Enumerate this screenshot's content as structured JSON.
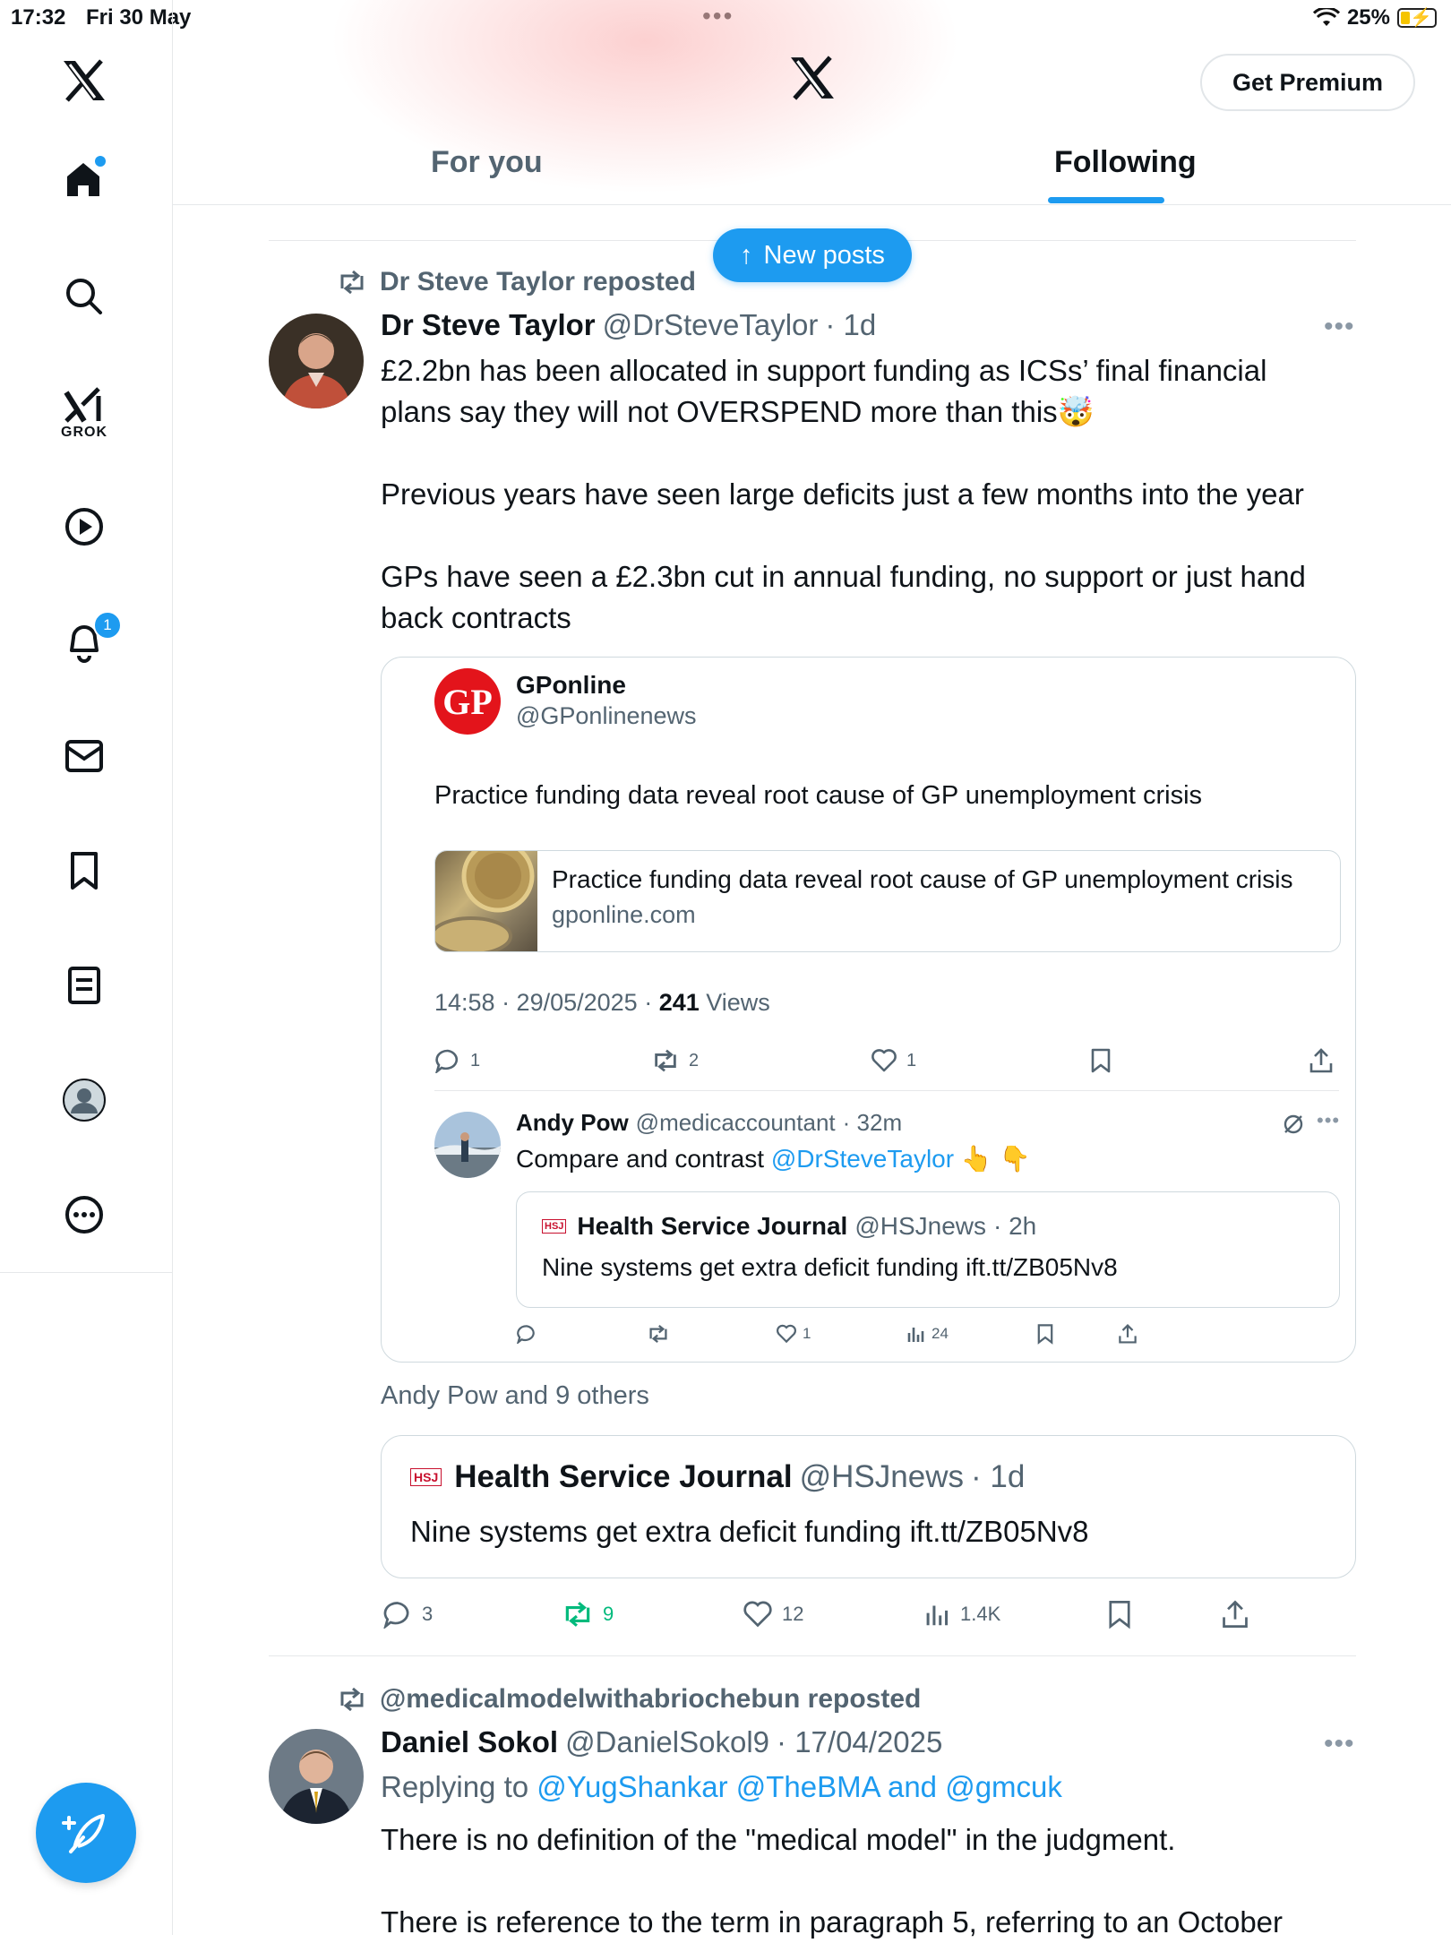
{
  "status_bar": {
    "time": "17:32",
    "date": "Fri 30 May",
    "dots": "•••",
    "battery": "25%"
  },
  "header": {
    "logo": "X",
    "premium_label": "Get Premium",
    "tabs": [
      {
        "label": "For you",
        "active": false
      },
      {
        "label": "Following",
        "active": true
      }
    ],
    "new_posts_label": "New posts"
  },
  "sidebar": {
    "items": [
      {
        "name": "home-icon",
        "badge_dot": true
      },
      {
        "name": "search-icon"
      },
      {
        "name": "grok-icon",
        "label": "GROK"
      },
      {
        "name": "video-icon"
      },
      {
        "name": "notifications-icon",
        "badge": "1"
      },
      {
        "name": "messages-icon"
      },
      {
        "name": "bookmarks-icon"
      },
      {
        "name": "articles-icon"
      },
      {
        "name": "profile-icon"
      },
      {
        "name": "more-icon"
      }
    ]
  },
  "post1": {
    "repost_label": "Dr Steve Taylor reposted",
    "name": "Dr Steve Taylor",
    "handle": "@DrSteveTaylor",
    "time": "· 1d",
    "text_p1a": "£2.2bn has been allocated in support funding as ICSs’ final financial",
    "text_p1b": "plans say they will not OVERSPEND more than this🤯",
    "text_p2": "Previous years have seen large deficits just a few months into the year",
    "text_p3a": "GPs have seen a £2.3bn cut in annual funding, no support or just hand",
    "text_p3b": "back contracts",
    "quote": {
      "name": "GPonline",
      "handle": "@GPonlinenews",
      "logo_text": "GP",
      "text": "Practice funding data reveal root cause of GP unemployment crisis",
      "link_title": "Practice funding data reveal root cause of GP unemployment crisis",
      "link_domain": "gponline.com",
      "timestamp": "14:58 · 29/05/2025 · ",
      "views_count": "241",
      "views_label": " Views",
      "actions": {
        "replies": "1",
        "reposts": "2",
        "likes": "1"
      },
      "reply": {
        "name": "Andy Pow",
        "handle": "@medicaccountant",
        "time": "· 32m",
        "text_prefix": "Compare and contrast ",
        "mention": "@DrSteveTaylor",
        "emoji": "👆 👇",
        "inner_quote": {
          "logo_text": "HSJ",
          "name": "Health Service Journal",
          "handle": "@HSJnews",
          "time": "· 2h",
          "text": "Nine systems get extra deficit funding ift.tt/ZB05Nv8"
        },
        "actions": {
          "likes": "1",
          "views": "24"
        }
      }
    },
    "social_context": "Andy Pow and 9 others",
    "quote2": {
      "logo_text": "HSJ",
      "name": "Health Service Journal",
      "handle": "@HSJnews",
      "time": "· 1d",
      "text": "Nine systems get extra deficit funding ift.tt/ZB05Nv8"
    },
    "actions": {
      "replies": "3",
      "reposts": "9",
      "likes": "12",
      "views": "1.4K"
    }
  },
  "post2": {
    "repost_label": "@medicalmodelwithabriochebun reposted",
    "name": "Daniel Sokol",
    "handle": "@DanielSokol9",
    "time": "· 17/04/2025",
    "replying_prefix": "Replying to ",
    "replying_to": "@YugShankar @TheBMA and @gmcuk",
    "text_p1": "There is no definition of the \"medical model\" in the judgment.",
    "text_p2": "There is reference to the term in paragraph 5, referring to an October"
  },
  "colors": {
    "accent": "#1d9bf0",
    "repost_green": "#00ba7c",
    "muted": "#536471",
    "gp_red": "#e3141b"
  }
}
